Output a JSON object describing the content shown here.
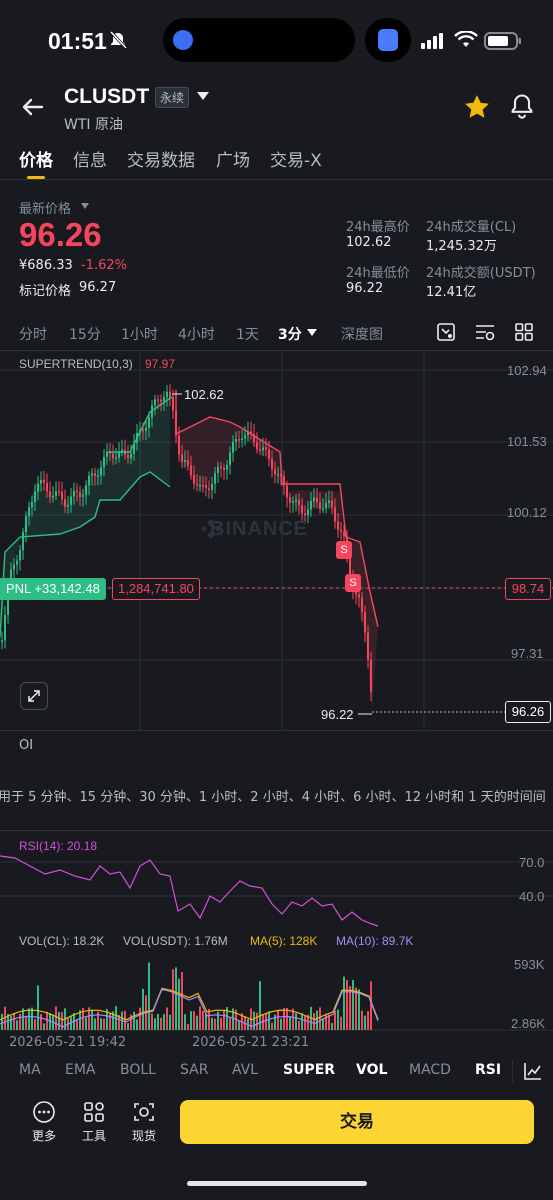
{
  "status_bar": {
    "time": "01:51"
  },
  "header": {
    "symbol": "CLUSDT",
    "contract_type": "永续",
    "subtitle": "WTI 原油"
  },
  "tabs": [
    "价格",
    "信息",
    "交易数据",
    "广场",
    "交易-X"
  ],
  "price": {
    "latest_label": "最新价格",
    "last": "96.26",
    "cny": "¥686.33",
    "change": "-1.62%",
    "mark_label": "标记价格",
    "mark": "96.27",
    "high_label": "24h最高价",
    "high": "102.62",
    "low_label": "24h最低价",
    "low": "96.22",
    "vol_label": "24h成交量(CL)",
    "vol": "1,245.32万",
    "turnover_label": "24h成交额(USDT)",
    "turnover": "12.41亿"
  },
  "intervals": [
    "分时",
    "15分",
    "1小时",
    "4小时",
    "1天",
    "3分",
    "深度图"
  ],
  "chart": {
    "indicator_label": "SUPERTREND(10,3)",
    "indicator_value": "97.97",
    "y_ticks": [
      "102.94",
      "101.53",
      "100.12",
      "97.31"
    ],
    "hi_label": "102.62",
    "lo_label": "96.22",
    "current_price": "96.26",
    "pnl_label": "PNL +33,142.48",
    "position_value": "1,284,741.80",
    "entry_price": "98.74",
    "signal": "S",
    "watermark": "BINANCE"
  },
  "oi_label": "OI",
  "oi_description": "用于 5 分钟、15 分钟、30 分钟、1 小时、2 小时、4 小时、6 小时、12 小时和 1 天的时间间",
  "rsi": {
    "label": "RSI(14): 20.18",
    "levels": [
      "70.0",
      "40.0"
    ]
  },
  "volume": {
    "vol_cl": "VOL(CL): 18.2K",
    "vol_usdt": "VOL(USDT): 1.76M",
    "ma5": "MA(5): 128K",
    "ma10": "MA(10): 89.7K",
    "max": "593K",
    "min": "2.86K"
  },
  "dates": [
    "2026-05-21 19:42",
    "2026-05-21 23:21"
  ],
  "indicators": [
    "MA",
    "EMA",
    "BOLL",
    "SAR",
    "AVL",
    "SUPER",
    "VOL",
    "MACD",
    "RSI"
  ],
  "bottom": {
    "more": "更多",
    "tools": "工具",
    "spot": "现货",
    "trade": "交易"
  },
  "colors": {
    "up": "#2ebd85",
    "down": "#f6465d",
    "accent": "#fcd535",
    "rsi": "#d64fd6",
    "ma5": "#f0b90b",
    "ma10": "#a58cf5"
  }
}
